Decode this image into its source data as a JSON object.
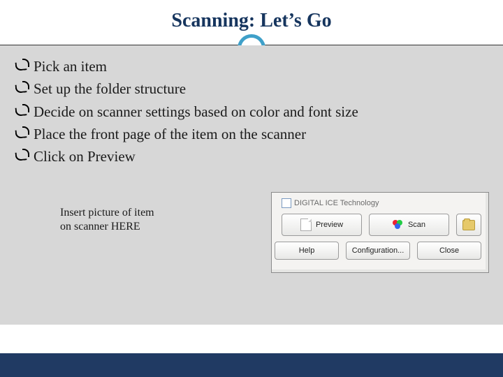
{
  "title": "Scanning: Let’s Go",
  "bullets": [
    "Pick an item",
    "Set up the folder structure",
    "Decide on scanner settings based on color and font size",
    "Place the front page of the item on the scanner",
    "Click on Preview"
  ],
  "caption": "Insert picture of item on scanner HERE",
  "dialog": {
    "checkbox_label": "DIGITAL ICE Technology",
    "buttons": {
      "preview": "Preview",
      "scan": "Scan",
      "help": "Help",
      "configuration": "Configuration...",
      "close": "Close"
    }
  }
}
